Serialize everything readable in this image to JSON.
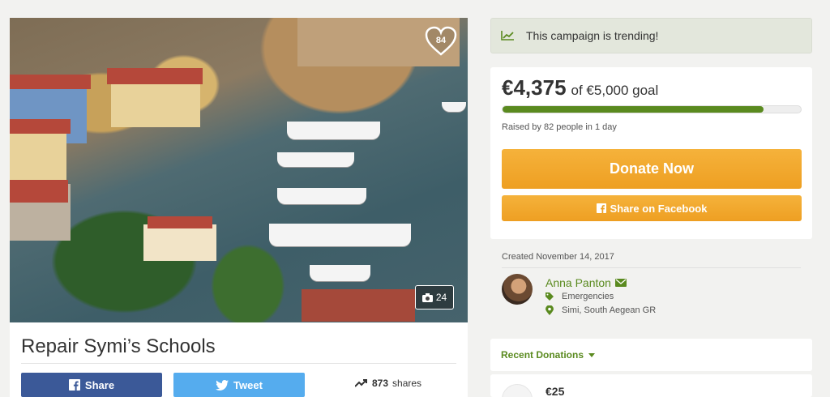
{
  "hero": {
    "likes": "84",
    "photo_count": "24"
  },
  "campaign": {
    "title": "Repair Symi’s Schools",
    "share_label": "Share",
    "tweet_label": "Tweet",
    "shares_count": "873",
    "shares_label": "shares"
  },
  "trending": {
    "text": "This campaign is trending!"
  },
  "donation": {
    "amount": "€4,375",
    "goal_text": "of €5,000 goal",
    "progress_fraction": 0.875,
    "raised_text": "Raised by 82 people in 1 day",
    "donate_label": "Donate Now",
    "facebook_label": "Share on Facebook"
  },
  "organizer": {
    "created": "Created November 14, 2017",
    "name": "Anna Panton",
    "category": "Emergencies",
    "location": "Simi, South Aegean GR"
  },
  "recent": {
    "label": "Recent Donations",
    "first_amount": "€25"
  },
  "colors": {
    "green": "#5a8a1f",
    "orange": "#ee9f22",
    "facebook": "#3b5998",
    "twitter": "#55acee"
  }
}
